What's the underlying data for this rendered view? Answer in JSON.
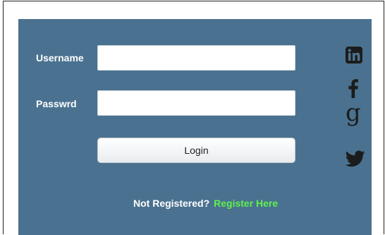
{
  "form": {
    "username_label": "Username",
    "username_value": "",
    "password_label": "Passwrd",
    "password_value": "",
    "login_label": "Login"
  },
  "footer": {
    "question": "Not Registered?",
    "register_link": "Register Here"
  },
  "social": {
    "icons": [
      "linkedin-icon",
      "facebook-icon",
      "google-icon",
      "twitter-icon"
    ],
    "google_glyph": "g"
  },
  "colors": {
    "panel_background": "#4a7290",
    "icon_color": "#1c1c1c",
    "register_link": "#5ff04c",
    "label_text": "#ffffff"
  }
}
